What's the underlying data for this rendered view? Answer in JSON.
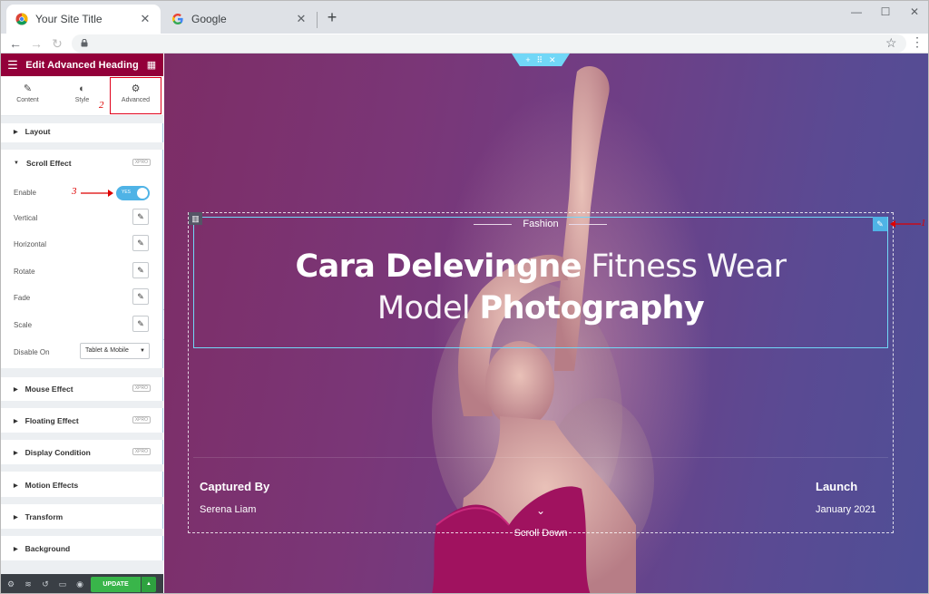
{
  "browser": {
    "tabs": [
      {
        "title": "Your Site Title",
        "close": "✕"
      },
      {
        "title": "Google",
        "close": "✕"
      }
    ],
    "new_tab": "+",
    "window_controls": {
      "minimize": "—",
      "maximize": "☐",
      "close": "✕"
    },
    "nav": {
      "back": "←",
      "forward": "→",
      "reload": "↻"
    },
    "star": "☆",
    "menu": "⋮"
  },
  "panel": {
    "title": "Edit Advanced Heading",
    "tabs": [
      {
        "label": "Content",
        "icon": "pencil-icon"
      },
      {
        "label": "Style",
        "icon": "half-circle-icon"
      },
      {
        "label": "Advanced",
        "icon": "gear-icon"
      }
    ],
    "sections": {
      "layout": "Layout",
      "scroll_effect": "Scroll Effect",
      "mouse_effect": "Mouse Effect",
      "floating_effect": "Floating Effect",
      "display_condition": "Display Condition",
      "motion_effects": "Motion Effects",
      "transform": "Transform",
      "background": "Background"
    },
    "pro_badge": "XPRO",
    "scroll_controls": {
      "enable": "Enable",
      "toggle_value": "YES",
      "vertical": "Vertical",
      "horizontal": "Horizontal",
      "rotate": "Rotate",
      "fade": "Fade",
      "scale": "Scale",
      "disable_on": "Disable On",
      "disable_on_value": "Tablet & Mobile"
    },
    "footer": {
      "update": "UPDATE"
    }
  },
  "annotations": {
    "n1": "1",
    "n2": "2",
    "n3": "3"
  },
  "canvas": {
    "eyebrow": "Fashion",
    "heading_line1_bold": "Cara Delevingne",
    "heading_line1_light": " Fitness Wear",
    "heading_line2_light": "Model ",
    "heading_line2_bold": "Photography",
    "captured_label": "Captured By",
    "captured_name": "Serena Liam",
    "launch_label": "Launch",
    "launch_date": "January 2021",
    "scroll_down": "Scroll Down"
  },
  "colors": {
    "panel_header": "#93003a",
    "accent": "#4fb3e6",
    "update_button": "#39b54a",
    "annotation_red": "#e0001b"
  }
}
